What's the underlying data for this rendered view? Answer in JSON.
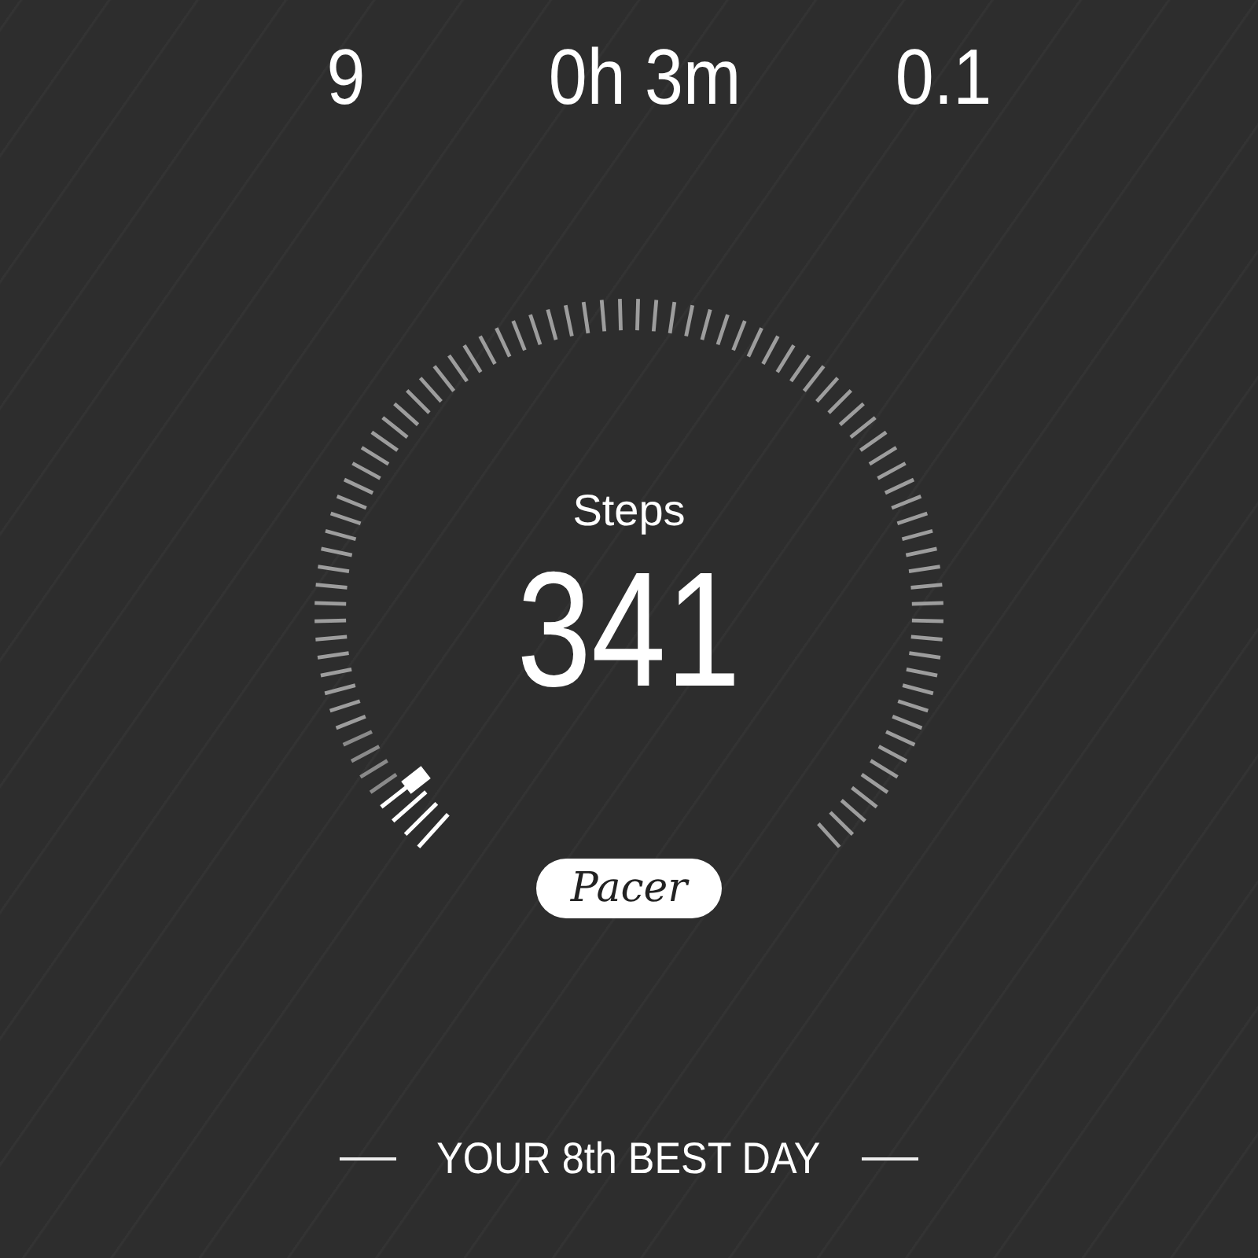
{
  "stats": [
    {
      "value": "9"
    },
    {
      "value": "0h 3m"
    },
    {
      "value": "0.1"
    }
  ],
  "gauge": {
    "label": "Steps",
    "value": "341"
  },
  "logo": "Pacer",
  "rank": "YOUR 8th BEST DAY"
}
